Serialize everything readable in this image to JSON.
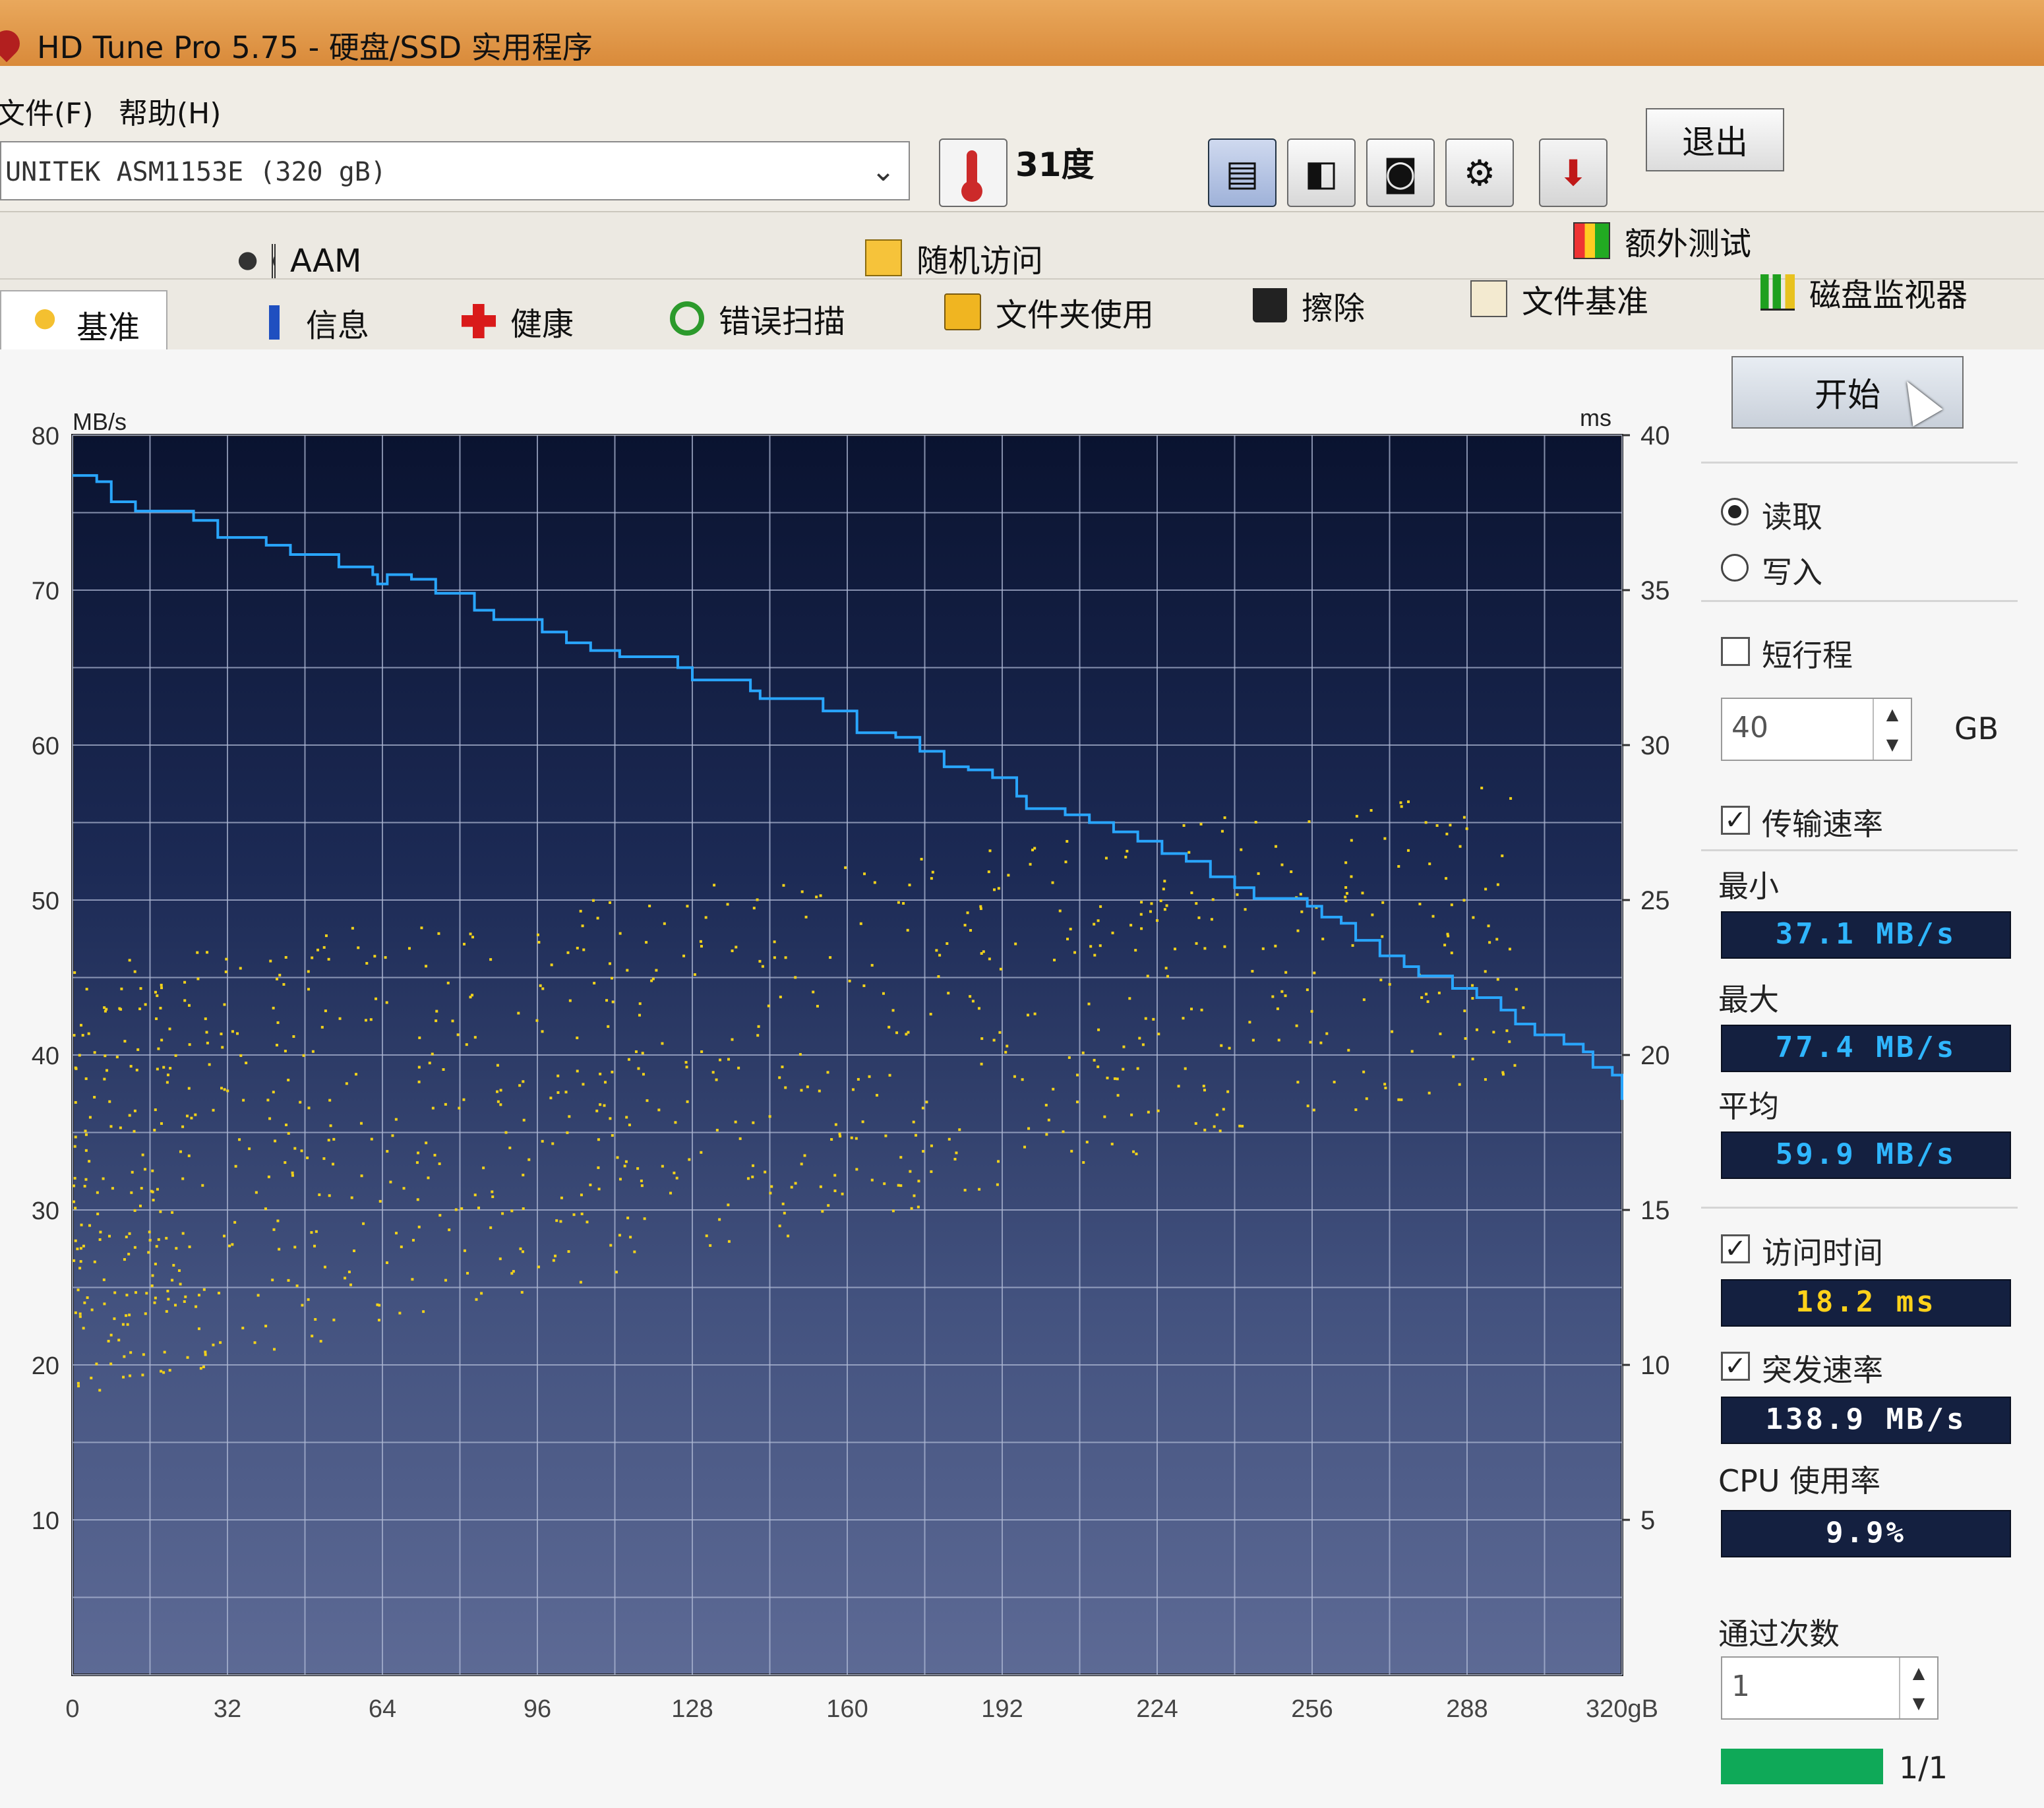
{
  "window": {
    "title": "HD Tune Pro 5.75 - 硬盘/SSD 实用程序"
  },
  "menu": [
    "文件(F)",
    "帮助(H)"
  ],
  "toolbar": {
    "drive": "UNITEK  ASM1153E (320 gB)",
    "temperature": "31度",
    "buttons": [
      "copy-text-icon",
      "copy-screenshot-icon",
      "camera-icon",
      "settings-icon",
      "save-down-icon"
    ],
    "exit_label": "退出"
  },
  "tabs_row1": [
    {
      "label": "AAM",
      "icon": "speaker-icon"
    },
    {
      "label": "随机访问",
      "icon": "random-access-icon"
    },
    {
      "label": "额外测试",
      "icon": "extra-tests-icon"
    }
  ],
  "tabs_row2": [
    {
      "label": "基准",
      "icon": "bulb-icon",
      "selected": true
    },
    {
      "label": "信息",
      "icon": "info-icon"
    },
    {
      "label": "健康",
      "icon": "health-cross-icon"
    },
    {
      "label": "错误扫描",
      "icon": "magnifier-icon"
    },
    {
      "label": "文件夹使用",
      "icon": "folder-icon"
    },
    {
      "label": "擦除",
      "icon": "trash-icon"
    },
    {
      "label": "文件基准",
      "icon": "file-benchmark-icon"
    },
    {
      "label": "磁盘监视器",
      "icon": "disk-monitor-icon"
    }
  ],
  "panel": {
    "start_label": "开始",
    "read_label": "读取",
    "write_label": "写入",
    "short_stroke_label": "短行程",
    "short_stroke_value": "40",
    "short_stroke_unit": "GB",
    "transfer_rate_label": "传输速率",
    "min_label": "最小",
    "min_value": "37.1 MB/s",
    "max_label": "最大",
    "max_value": "77.4 MB/s",
    "avg_label": "平均",
    "avg_value": "59.9 MB/s",
    "access_time_label": "访问时间",
    "access_time_value": "18.2 ms",
    "burst_rate_label": "突发速率",
    "burst_rate_value": "138.9 MB/s",
    "cpu_label": "CPU 使用率",
    "cpu_value": "9.9%",
    "passes_label": "通过次数",
    "passes_value": "1",
    "progress_text": "1/1",
    "progress_fraction": 1.0
  },
  "colors": {
    "lcd_cyan": "#2fb6ff",
    "lcd_yellow": "#ffd21a",
    "lcd_white": "#ffffff",
    "line": "#29a6ff",
    "dots": "#f2d21a",
    "progress": "#0fa958"
  },
  "chart_data": {
    "type": "line",
    "y_left_unit": "MB/s",
    "y_right_unit": "ms",
    "x_unit": "gB",
    "x_ticks": [
      "0",
      "32",
      "64",
      "96",
      "128",
      "160",
      "192",
      "224",
      "256",
      "288",
      "320gB"
    ],
    "y_left_ticks": [
      "10",
      "20",
      "30",
      "40",
      "50",
      "60",
      "70",
      "80"
    ],
    "y_right_ticks": [
      "5",
      "10",
      "15",
      "20",
      "25",
      "30",
      "35",
      "40"
    ],
    "xlim": [
      0,
      320
    ],
    "ylim_left": [
      0,
      80
    ],
    "ylim_right": [
      0,
      40
    ],
    "grid": true,
    "series": [
      {
        "kind": "transfer_rate",
        "x": [
          0,
          5,
          8,
          13,
          25,
          30,
          40,
          45,
          55,
          62,
          63,
          65,
          70,
          75,
          83,
          87,
          93,
          97,
          102,
          107,
          113,
          125,
          128,
          140,
          142,
          155,
          162,
          170,
          175,
          180,
          185,
          190,
          195,
          197,
          205,
          210,
          215,
          220,
          225,
          230,
          235,
          240,
          244,
          250,
          255,
          258,
          262,
          265,
          270,
          275,
          278,
          285,
          290,
          295,
          298,
          302,
          308,
          312,
          314,
          318,
          320
        ],
        "y": [
          77.4,
          77.0,
          75.7,
          75.1,
          74.5,
          73.4,
          72.9,
          72.3,
          71.5,
          71.0,
          70.4,
          71.0,
          70.7,
          69.8,
          68.7,
          68.1,
          68.1,
          67.3,
          66.6,
          66.1,
          65.7,
          65.0,
          64.2,
          63.5,
          63.0,
          62.2,
          60.8,
          60.5,
          59.6,
          58.6,
          58.4,
          57.9,
          56.7,
          55.9,
          55.5,
          55.0,
          54.4,
          53.8,
          53.0,
          52.5,
          51.5,
          50.8,
          50.1,
          50.1,
          49.6,
          48.9,
          48.5,
          47.4,
          46.4,
          45.7,
          45.1,
          44.3,
          43.7,
          42.9,
          42.0,
          41.3,
          40.7,
          40.2,
          39.2,
          38.7,
          37.1
        ]
      }
    ]
  }
}
